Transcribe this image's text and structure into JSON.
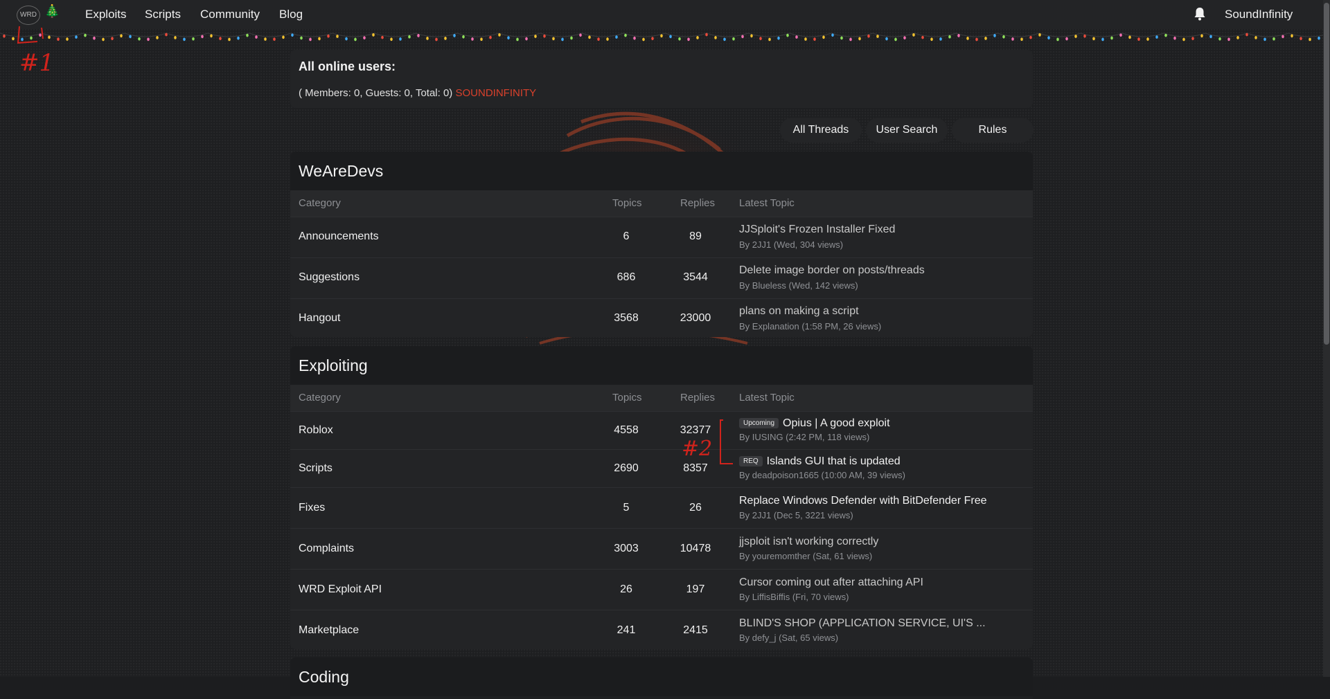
{
  "nav": {
    "logo": "WRD",
    "links": [
      "Exploits",
      "Scripts",
      "Community",
      "Blog"
    ],
    "user": "SoundInfinity"
  },
  "annotations": {
    "first": "#1",
    "second": "#2"
  },
  "online": {
    "title": "All online users:",
    "stats": "( Members: 0, Guests: 0, Total: 0)",
    "user": "SOUNDINFINITY"
  },
  "buttons": [
    "All Threads",
    "User Search",
    "Rules"
  ],
  "columns": {
    "category": "Category",
    "topics": "Topics",
    "replies": "Replies",
    "latest": "Latest Topic"
  },
  "sections": [
    {
      "title": "WeAreDevs",
      "rows": [
        {
          "category": "Announcements",
          "topics": "6",
          "replies": "89",
          "latest": "JJSploit's Frozen Installer Fixed",
          "by": "By 2JJ1 (Wed, 304 views)"
        },
        {
          "category": "Suggestions",
          "topics": "686",
          "replies": "3544",
          "latest": "Delete image border on posts/threads",
          "by": "By Blueless (Wed, 142 views)"
        },
        {
          "category": "Hangout",
          "topics": "3568",
          "replies": "23000",
          "latest": "plans on making a script",
          "by": "By Explanation (1:58 PM, 26 views)"
        }
      ]
    },
    {
      "title": "Exploiting",
      "rows": [
        {
          "category": "Roblox",
          "topics": "4558",
          "replies": "32377",
          "tag": "Upcoming",
          "latest": "Opius | A good exploit",
          "by": "By IUSING (2:42 PM, 118 views)"
        },
        {
          "category": "Scripts",
          "topics": "2690",
          "replies": "8357",
          "tag": "REQ",
          "latest": "Islands GUI that is updated",
          "by": "By deadpoison1665 (10:00 AM, 39 views)"
        },
        {
          "category": "Fixes",
          "topics": "5",
          "replies": "26",
          "latest": "Replace Windows Defender with BitDefender Free",
          "by": "By 2JJ1 (Dec 5, 3221 views)"
        },
        {
          "category": "Complaints",
          "topics": "3003",
          "replies": "10478",
          "latest": "jjsploit isn't working correctly",
          "by": "By youremomther (Sat, 61 views)"
        },
        {
          "category": "WRD Exploit API",
          "topics": "26",
          "replies": "197",
          "latest": "Cursor coming out after attaching API",
          "by": "By LiffisBiffis (Fri, 70 views)"
        },
        {
          "category": "Marketplace",
          "topics": "241",
          "replies": "2415",
          "latest": "BLIND'S SHOP (APPLICATION SERVICE, UI'S ...",
          "by": "By defy_j (Sat, 65 views)"
        }
      ]
    },
    {
      "title": "Coding"
    }
  ],
  "colors": {
    "accent": "#d9412c",
    "background": "#1c1d1f",
    "panel": "#232426"
  }
}
